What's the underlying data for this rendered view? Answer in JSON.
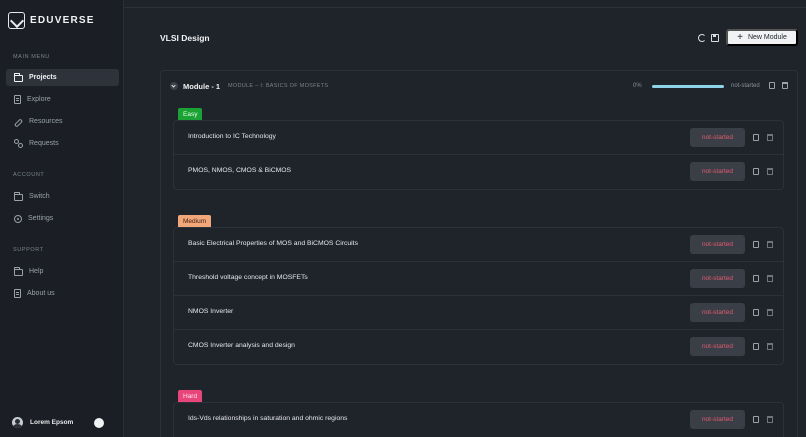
{
  "app": {
    "name": "EDUVERSE"
  },
  "sidebar": {
    "main_menu_label": "MAIN MENU",
    "main_items": [
      {
        "label": "Projects",
        "icon": "folder-icon",
        "active": true
      },
      {
        "label": "Explore",
        "icon": "document-icon"
      },
      {
        "label": "Resources",
        "icon": "link-icon"
      },
      {
        "label": "Requests",
        "icon": "pull-request-icon"
      }
    ],
    "account_label": "ACCOUNT",
    "account_items": [
      {
        "label": "Switch",
        "icon": "folder-icon"
      },
      {
        "label": "Settings",
        "icon": "gear-icon"
      }
    ],
    "support_label": "SUPPORT",
    "support_items": [
      {
        "label": "Help",
        "icon": "folder-icon"
      },
      {
        "label": "About us",
        "icon": "document-icon"
      }
    ],
    "user": {
      "name": "Lorem Epsom"
    }
  },
  "header": {
    "title": "VLSI Design",
    "new_module_label": "New Module"
  },
  "module": {
    "name": "Module - 1",
    "subtitle": "MODULE – I: BASICS OF MOSFETS",
    "progress_text": "0%",
    "progress": 0,
    "status": "not-started"
  },
  "groups": {
    "easy": {
      "label": "Easy",
      "color": "#1aa235",
      "items": [
        {
          "title": "Introduction to IC Technology",
          "status": "not-started"
        },
        {
          "title": "PMOS, NMOS, CMOS & BiCMOS",
          "status": "not-started"
        }
      ]
    },
    "medium": {
      "label": "Medium",
      "color": "#f2a77b",
      "items": [
        {
          "title": "Basic Electrical Properties of MOS and BiCMOS Circuits",
          "status": "not-started"
        },
        {
          "title": "Threshold voltage concept in MOSFETs",
          "status": "not-started"
        },
        {
          "title": "NMOS Inverter",
          "status": "not-started"
        },
        {
          "title": "CMOS Inverter analysis and design",
          "status": "not-started"
        }
      ]
    },
    "hard": {
      "label": "Hard",
      "color": "#e8457a",
      "items": [
        {
          "title": "Ids-Vds relationships in saturation and ohmic regions",
          "status": "not-started"
        }
      ]
    }
  }
}
